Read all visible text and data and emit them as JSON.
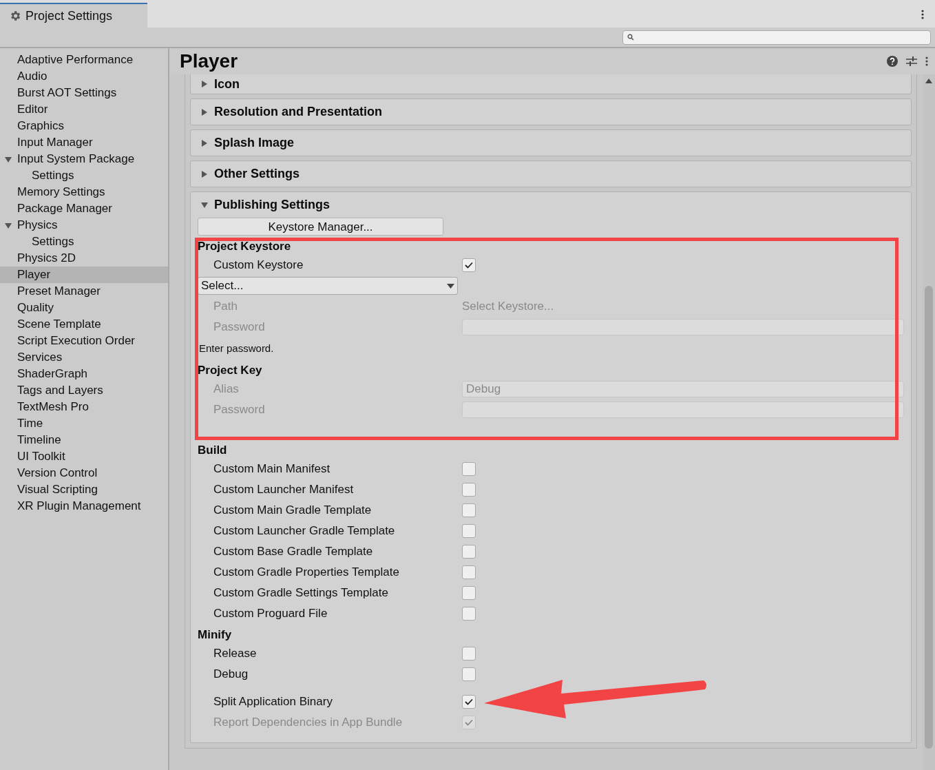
{
  "window": {
    "tab": "Project Settings"
  },
  "sidebar": {
    "items": [
      {
        "label": "Adaptive Performance",
        "selected": false
      },
      {
        "label": "Audio",
        "selected": false
      },
      {
        "label": "Burst AOT Settings",
        "selected": false
      },
      {
        "label": "Editor",
        "selected": false
      },
      {
        "label": "Graphics",
        "selected": false
      },
      {
        "label": "Input Manager",
        "selected": false
      },
      {
        "label": "Input System Package",
        "selected": false,
        "expanded": true,
        "children": [
          {
            "label": "Settings",
            "selected": false
          }
        ]
      },
      {
        "label": "Memory Settings",
        "selected": false
      },
      {
        "label": "Package Manager",
        "selected": false
      },
      {
        "label": "Physics",
        "selected": false,
        "expanded": true,
        "children": [
          {
            "label": "Settings",
            "selected": false
          }
        ]
      },
      {
        "label": "Physics 2D",
        "selected": false
      },
      {
        "label": "Player",
        "selected": true
      },
      {
        "label": "Preset Manager",
        "selected": false
      },
      {
        "label": "Quality",
        "selected": false
      },
      {
        "label": "Scene Template",
        "selected": false
      },
      {
        "label": "Script Execution Order",
        "selected": false
      },
      {
        "label": "Services",
        "selected": false
      },
      {
        "label": "ShaderGraph",
        "selected": false
      },
      {
        "label": "Tags and Layers",
        "selected": false
      },
      {
        "label": "TextMesh Pro",
        "selected": false
      },
      {
        "label": "Time",
        "selected": false
      },
      {
        "label": "Timeline",
        "selected": false
      },
      {
        "label": "UI Toolkit",
        "selected": false
      },
      {
        "label": "Version Control",
        "selected": false
      },
      {
        "label": "Visual Scripting",
        "selected": false
      },
      {
        "label": "XR Plugin Management",
        "selected": false
      }
    ]
  },
  "main": {
    "title": "Player",
    "sections": [
      {
        "title": "Icon",
        "expanded": false
      },
      {
        "title": "Resolution and Presentation",
        "expanded": false
      },
      {
        "title": "Splash Image",
        "expanded": false
      },
      {
        "title": "Other Settings",
        "expanded": false
      },
      {
        "title": "Publishing Settings",
        "expanded": true,
        "button": "Keystore Manager...",
        "rows": [
          {
            "kind": "heading",
            "label": "Project Keystore"
          },
          {
            "kind": "checkbox",
            "label": "Custom Keystore",
            "checked": true,
            "disabled": false
          },
          {
            "kind": "dropdown",
            "value": "Select..."
          },
          {
            "kind": "value",
            "label": "Path",
            "value": "Select Keystore...",
            "disabled": true
          },
          {
            "kind": "input",
            "label": "Password",
            "disabled": true
          },
          {
            "kind": "note",
            "label": "Enter password."
          },
          {
            "kind": "heading",
            "label": "Project Key"
          },
          {
            "kind": "select",
            "label": "Alias",
            "value": "Debug",
            "disabled": true
          },
          {
            "kind": "input",
            "label": "Password",
            "disabled": true
          },
          {
            "kind": "spacer"
          },
          {
            "kind": "heading",
            "label": "Build"
          },
          {
            "kind": "checkbox",
            "label": "Custom Main Manifest",
            "checked": false,
            "disabled": false
          },
          {
            "kind": "checkbox",
            "label": "Custom Launcher Manifest",
            "checked": false,
            "disabled": false
          },
          {
            "kind": "checkbox",
            "label": "Custom Main Gradle Template",
            "checked": false,
            "disabled": false
          },
          {
            "kind": "checkbox",
            "label": "Custom Launcher Gradle Template",
            "checked": false,
            "disabled": false
          },
          {
            "kind": "checkbox",
            "label": "Custom Base Gradle Template",
            "checked": false,
            "disabled": false
          },
          {
            "kind": "checkbox",
            "label": "Custom Gradle Properties Template",
            "checked": false,
            "disabled": false
          },
          {
            "kind": "checkbox",
            "label": "Custom Gradle Settings Template",
            "checked": false,
            "disabled": false
          },
          {
            "kind": "checkbox",
            "label": "Custom Proguard File",
            "checked": false,
            "disabled": false
          },
          {
            "kind": "heading",
            "label": "Minify"
          },
          {
            "kind": "checkbox",
            "label": "Release",
            "checked": false,
            "disabled": false
          },
          {
            "kind": "checkbox",
            "label": "Debug",
            "checked": false,
            "disabled": false
          },
          {
            "kind": "gap"
          },
          {
            "kind": "checkbox",
            "label": "Split Application Binary",
            "checked": true,
            "disabled": false
          },
          {
            "kind": "checkbox",
            "label": "Report Dependencies in App Bundle",
            "checked": true,
            "disabled": true
          }
        ]
      }
    ]
  }
}
